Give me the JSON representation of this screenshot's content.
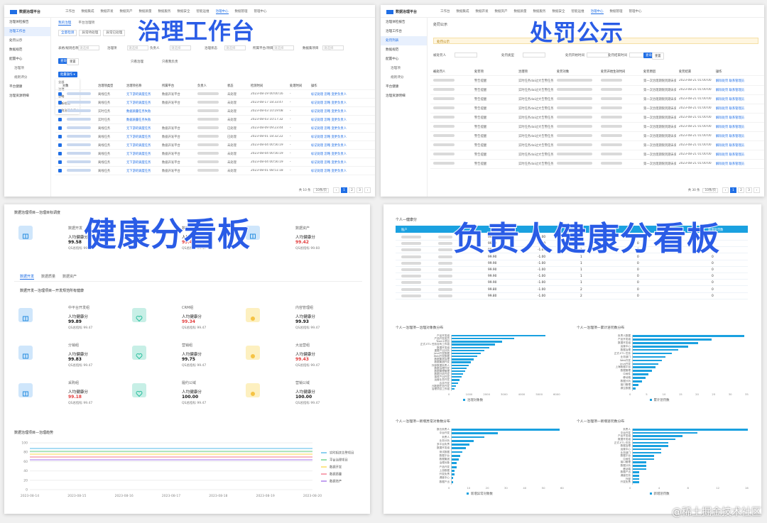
{
  "panel_governance": {
    "big_title": "治理工作台",
    "top_menu": [
      "工作台",
      "数据集成",
      "数据开发",
      "数据资产",
      "数据质量",
      "数据服务",
      "数据安全",
      "智能运维",
      "治理中心",
      "数据管理",
      "管理中心"
    ],
    "active_menu": "治理中心",
    "sidebar": [
      {
        "label": "治理体检报告",
        "on": false,
        "sub": false
      },
      {
        "label": "治理工作台",
        "on": true,
        "sub": false
      },
      {
        "label": "处罚公示",
        "on": false,
        "sub": false
      },
      {
        "label": "数据规范",
        "on": false,
        "sub": false
      },
      {
        "label": "配置中心",
        "on": false,
        "sub": false
      },
      {
        "label": "治理项",
        "on": false,
        "sub": true
      },
      {
        "label": "规则评分",
        "on": false,
        "sub": true
      },
      {
        "label": "平台健康",
        "on": false,
        "sub": false
      },
      {
        "label": "治理资源明细",
        "on": false,
        "sub": false
      }
    ],
    "tabs": [
      "我的治理",
      "平台治理项"
    ],
    "sub_tabs": [
      "全量检测",
      "异常待处理",
      "异常已处理"
    ],
    "filters": [
      "表格/规则名称",
      "治理项",
      "负责人",
      "治理状态",
      "所属平台/项目",
      "数据集项目"
    ],
    "filter_placeholder": "请选择",
    "search_button": "查询",
    "reset_button": "重置",
    "check_labels": [
      "只看治理",
      "只看我负责"
    ],
    "bulk_button": "批量操作",
    "bulk_menu": [
      "全部",
      "治理",
      "忽略",
      "重新检测",
      "修改治理负责人"
    ],
    "columns": [
      "对象",
      "治理项类型",
      "治理项名称",
      "所属平台",
      "负责人",
      "状态",
      "检测时间",
      "处理时间",
      "操作"
    ],
    "rows": [
      {
        "type": "离线任务",
        "name": "无下游的调度任务",
        "platform": "数据开发平台",
        "status": "未处理",
        "time": "2023-08-19 00:00:16",
        "done": "-",
        "ops": "标记处理  忽略  变更负责人"
      },
      {
        "type": "离线任务",
        "name": "无下游的调度任务",
        "platform": "数据开发平台",
        "status": "未处理",
        "time": "2023-08-17 18:33:47",
        "done": "-",
        "ops": "标记处理  忽略  变更负责人"
      },
      {
        "type": "实时任务",
        "name": "数据质量任务失败",
        "platform": "",
        "status": "未处理",
        "time": "2023-08-03 10:19:08",
        "done": "-",
        "ops": "标记处理  忽略  变更负责人"
      },
      {
        "type": "实时任务",
        "name": "数据质量任务失败",
        "platform": "",
        "status": "未处理",
        "time": "2023-08-03 10:17:32",
        "done": "-",
        "ops": "标记处理  忽略  变更负责人"
      },
      {
        "type": "离线任务",
        "name": "无下游的调度任务",
        "platform": "数据开发平台",
        "status": "已处理",
        "time": "2023-08-09 09:23:44",
        "done": "-",
        "ops": "标记处理  忽略  变更负责人"
      },
      {
        "type": "离线任务",
        "name": "无下游的调度任务",
        "platform": "数据开发平台",
        "status": "已处理",
        "time": "2023-08-01 18:32:22",
        "done": "-",
        "ops": "标记处理  忽略  变更负责人"
      },
      {
        "type": "离线任务",
        "name": "无下游的调度任务",
        "platform": "数据开发平台",
        "status": "未处理",
        "time": "2023-08-04 00:56:19",
        "done": "-",
        "ops": "标记处理  忽略  变更负责人"
      },
      {
        "type": "离线任务",
        "name": "无下游的调度任务",
        "platform": "数据开发平台",
        "status": "未处理",
        "time": "2023-08-04 00:56:19",
        "done": "-",
        "ops": "标记处理  忽略  变更负责人"
      },
      {
        "type": "离线任务",
        "name": "无下游的调度任务",
        "platform": "数据开发平台",
        "status": "未处理",
        "time": "2023-08-04 00:56:19",
        "done": "-",
        "ops": "标记处理  忽略  变更负责人"
      },
      {
        "type": "离线任务",
        "name": "无下游的调度任务",
        "platform": "数据开发平台",
        "status": "未处理",
        "time": "2023-08-01 08:51:18",
        "done": "-",
        "ops": "标记处理  忽略  变更负责人"
      }
    ],
    "pager_total": "共 10 条",
    "pager_size": "10条/页",
    "pages": [
      "1",
      "2",
      "3"
    ],
    "active_page": "1"
  },
  "panel_penalty": {
    "big_title": "处罚公示",
    "top_menu": [
      "工作台",
      "数据集成",
      "数据开发",
      "数据资产",
      "数据质量",
      "数据服务",
      "数据安全",
      "智能运维",
      "治理中心",
      "数据管理",
      "管理中心"
    ],
    "active_menu": "治理中心",
    "sidebar": [
      {
        "label": "治理体检报告",
        "on": false,
        "sub": false
      },
      {
        "label": "治理工作台",
        "on": false,
        "sub": false
      },
      {
        "label": "处罚列表",
        "on": true,
        "sub": false
      },
      {
        "label": "数据规范",
        "on": false,
        "sub": false
      },
      {
        "label": "配置中心",
        "on": false,
        "sub": false
      },
      {
        "label": "治理项",
        "on": false,
        "sub": true
      },
      {
        "label": "规则评分",
        "on": false,
        "sub": true
      },
      {
        "label": "平台健康",
        "on": false,
        "sub": false
      },
      {
        "label": "治理资源明细",
        "on": false,
        "sub": false
      }
    ],
    "page_title": "处罚公示",
    "notice": "处罚公示",
    "filters": [
      "被处罚人",
      "处罚类型",
      "处罚开始时间",
      "处罚结束时间"
    ],
    "search_button": "查询",
    "reset_button": "重置",
    "columns": [
      "被处罚人",
      "处罚项",
      "治理项",
      "处罚对象",
      "处罚开始生效时间",
      "处罚原因",
      "处罚结束",
      "操作"
    ],
    "rows_count": 10,
    "row": {
      "punish": "警告提醒",
      "item": "实时任务dal过大告警任务",
      "reason": "第一次治理期限到期未处理",
      "time": "2023-08-21 01:00:00",
      "ops": "解除处罚  联系管理员"
    },
    "pager_total": "共 30 条",
    "pager_size": "10条/页",
    "pages": [
      "1",
      "2",
      "3"
    ],
    "active_page": "1"
  },
  "panel_health": {
    "big_title": "健康分看板",
    "header": "数据治理项目—治理目标调度",
    "top_groups": [
      {
        "name": "数据开发",
        "label": "人均健康分",
        "score": "99.58",
        "red": false,
        "qs": "QS总指标",
        "qv": "99.47"
      },
      {
        "name": "数据质量",
        "label": "人均健康分",
        "score": "99.43",
        "red": true,
        "qs": "QS总指标",
        "qv": "99.47"
      },
      {
        "name": "数据资产",
        "label": "人均健康分",
        "score": "99.42",
        "red": true,
        "qs": "QS总指标",
        "qv": "99.60"
      }
    ],
    "tabs": [
      "数据开发",
      "数据质量",
      "数据资产"
    ],
    "active_tab": "数据开发",
    "section_title": "数据开发—治理项目—开发规范所有健康",
    "cards": [
      {
        "title": "中平台开发组",
        "label": "人均健康分",
        "score": "99.89",
        "red": false,
        "qv": "99.47",
        "icon": "book-icon",
        "color": "#cfe6fb"
      },
      {
        "title": "CRM组",
        "label": "人均健康分",
        "score": "99.34",
        "red": true,
        "qv": "99.47",
        "icon": "heart-icon",
        "color": "#c7efe6"
      },
      {
        "title": "内容管理组",
        "label": "人均健康分",
        "score": "99.93",
        "red": false,
        "qv": "99.47",
        "icon": "sun-icon",
        "color": "#fdf0c0"
      },
      {
        "title": "分销组",
        "label": "人均健康分",
        "score": "99.83",
        "red": false,
        "qv": "99.47",
        "icon": "book-icon",
        "color": "#cfe6fb"
      },
      {
        "title": "营销组",
        "label": "人均健康分",
        "score": "99.75",
        "red": false,
        "qv": "99.47",
        "icon": "heart-icon",
        "color": "#c7efe6"
      },
      {
        "title": "大运营组",
        "label": "人均健康分",
        "score": "99.43",
        "red": true,
        "qv": "99.47",
        "icon": "sun-icon",
        "color": "#fdf0c0"
      },
      {
        "title": "采购组",
        "label": "人均健康分",
        "score": "99.18",
        "red": true,
        "qv": "99.47",
        "icon": "book-icon",
        "color": "#cfe6fb"
      },
      {
        "title": "履约公域",
        "label": "人均健康分",
        "score": "100.00",
        "red": false,
        "qv": "99.47",
        "icon": "heart-icon",
        "color": "#c7efe6"
      },
      {
        "title": "营销公域",
        "label": "人均健康分",
        "score": "100.00",
        "red": false,
        "qv": "99.47",
        "icon": "sun-icon",
        "color": "#fdf0c0"
      }
    ],
    "qs_label": "QS总指标",
    "trend_title": "数据治理项目—治理趋势",
    "y_ticks": [
      "100",
      "80",
      "60",
      "40",
      "20",
      "0"
    ],
    "x_ticks": [
      "2023-08-14",
      "2023-08-15",
      "2023-08-16",
      "2023-08-17",
      "2023-08-18",
      "2023-08-19",
      "2023-08-20"
    ],
    "legend": [
      {
        "name": "实时相关告警项目",
        "color": "#1aa1e0"
      },
      {
        "name": "平台治理项目",
        "color": "#2fc25b"
      },
      {
        "name": "数据开发",
        "color": "#facc14"
      },
      {
        "name": "数据质量",
        "color": "#f04864"
      },
      {
        "name": "数据资产",
        "color": "#8543e0"
      }
    ]
  },
  "panel_owner": {
    "big_title": "负责人健康分看板",
    "table_title": "个人—健康分",
    "columns": [
      "账户",
      "",
      "",
      "",
      "",
      "",
      "新增处罚数"
    ],
    "rows": [
      {
        "v1": "99.90",
        "v2": "-1.00",
        "v3": "1",
        "v4": "0",
        "v5": "0"
      },
      {
        "v1": "99.90",
        "v2": "-1.00",
        "v3": "1",
        "v4": "0",
        "v5": "0"
      },
      {
        "v1": "99.90",
        "v2": "-1.00",
        "v3": "1",
        "v4": "0",
        "v5": "0"
      },
      {
        "v1": "99.90",
        "v2": "-1.00",
        "v3": "1",
        "v4": "0",
        "v5": "0"
      },
      {
        "v1": "99.90",
        "v2": "-1.00",
        "v3": "1",
        "v4": "0",
        "v5": "0"
      },
      {
        "v1": "99.90",
        "v2": "-1.00",
        "v3": "1",
        "v4": "0",
        "v5": "0"
      },
      {
        "v1": "99.90",
        "v2": "-1.00",
        "v3": "1",
        "v4": "0",
        "v5": "0"
      },
      {
        "v1": "99.90",
        "v2": "-1.00",
        "v3": "1",
        "v4": "0",
        "v5": "0"
      },
      {
        "v1": "99.80",
        "v2": "-1.00",
        "v3": "2",
        "v4": "0",
        "v5": "0"
      },
      {
        "v1": "99.80",
        "v2": "-1.00",
        "v3": "2",
        "v4": "0",
        "v5": "0"
      }
    ]
  },
  "chart_data": [
    {
      "type": "bar",
      "title": "个人—治理项—治理对象数分布",
      "legend": "治理对象数",
      "xlim": [
        0,
        6000
      ],
      "x_ticks": [
        "0",
        "1000",
        "2000",
        "3000",
        "4000",
        "5000",
        "6000"
      ],
      "categories": [
        "产品开发组",
        "产品开发成员",
        "Team1项目",
        "正式-ETL 任务自有工作组",
        "数据开发组",
        "重要产出分析",
        "Java开发数据",
        "Web开发数据",
        "数据集团治理",
        "数据集团开发",
        "外部数据负责人",
        "数据治理开发",
        "数据管理管理",
        "数据分析开发",
        "接收产出开发",
        "运营业务开发",
        "合并开发",
        "元数据任务开发",
        "治理项目工作组"
      ],
      "values": [
        5400,
        3600,
        2900,
        2500,
        2200,
        1900,
        1700,
        1500,
        1300,
        1150,
        1000,
        900,
        800,
        700,
        600,
        500,
        400,
        300,
        200
      ]
    },
    {
      "type": "bar",
      "title": "个人—治理项—累计惩罚数分布",
      "legend": "累计惩罚数",
      "xlim": [
        0,
        35
      ],
      "x_ticks": [
        "0",
        "5",
        "10",
        "15",
        "20",
        "25",
        "30",
        "35"
      ],
      "categories": [
        "负责人数据",
        "产品开发组",
        "数据开发组",
        "运营中心",
        "数据治理",
        "正式-ETL 任务",
        "业务部门",
        "Web开发",
        "Java开发",
        "上海数据平台",
        "数据管理",
        "中间件",
        "移动端",
        "数据分析",
        "接口管理",
        "源生数据"
      ],
      "values": [
        34,
        24,
        20,
        17,
        14,
        12,
        10,
        9,
        8,
        7,
        6,
        5,
        4,
        3,
        2,
        1
      ]
    },
    {
      "type": "bar",
      "title": "个人—治理项—新增异常对象数分布",
      "legend": "新增异常对象数",
      "xlim": [
        0,
        60
      ],
      "x_ticks": [
        "0",
        "10",
        "20",
        "30",
        "40",
        "50",
        "60"
      ],
      "categories": [
        "数仓负责人",
        "中台开发",
        "负责人",
        "业务分析",
        "多平台负责",
        "数据开发组",
        "测试数据",
        "数据平台",
        "数据集团",
        "治理对象",
        "产品开发",
        "上游数据",
        "开发负责",
        "调度中心",
        "数据产出"
      ],
      "values": [
        58,
        25,
        18,
        12,
        10,
        8,
        6,
        5,
        4,
        3,
        3,
        2,
        2,
        1,
        1
      ]
    },
    {
      "type": "bar",
      "title": "个人—治理项—新增惩罚数分布",
      "legend": "新增惩罚数",
      "xlim": [
        0,
        16
      ],
      "x_ticks": [
        "0",
        "4",
        "8",
        "12",
        "16"
      ],
      "categories": [
        "负责人",
        "中台开发",
        "产品开发组",
        "数据开发组",
        "正式-ETL 任务",
        "数据治理",
        "运营中心",
        "业务部门",
        "数据平台",
        "中间件",
        "接口管理",
        "数据分析",
        "移动端",
        "数据产出",
        "调度任务",
        "外部",
        "开发负责"
      ],
      "values": [
        16,
        9,
        7,
        6,
        5,
        5,
        4,
        4,
        3,
        3,
        2,
        2,
        2,
        1,
        1,
        1,
        1
      ]
    }
  ],
  "watermark": "@稀土掘金技术社区"
}
